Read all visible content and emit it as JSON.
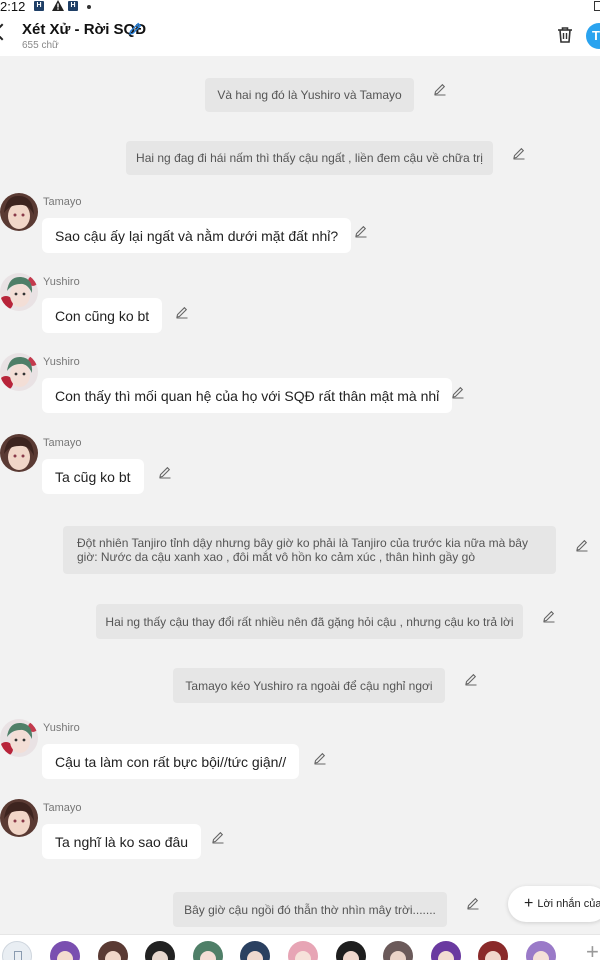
{
  "status": {
    "time": "2:12"
  },
  "header": {
    "title": "Xét Xử - Rời SQĐ",
    "subtitle": "655 chữ",
    "avatar_letter": "T"
  },
  "narrations": [
    "Và hai ng đó là Yushiro và Tamayo",
    "Hai ng đag đi hái nấm thì thấy cậu ngất , liền đem cậu về chữa trị",
    "Đột nhiên Tanjiro tỉnh dậy nhưng bây giờ ko phải là Tanjiro của trước kia nữa mà bây giờ: Nước da cậu xanh xao , đôi mắt vô hồn ko cảm xúc , thân hình gầy gò",
    "Hai ng thấy cậu thay đổi rất nhiều nên đã gặng hỏi cậu , nhưng cậu ko trả lời",
    "Tamayo kéo Yushiro ra ngoài để cậu nghỉ ngơi",
    "Bây giờ cậu ngồi đó thẫn thờ nhìn mây trời......."
  ],
  "messages": [
    {
      "speaker": "Tamayo",
      "text": "Sao cậu ấy lại ngất và nằm dưới mặt đất nhỉ?"
    },
    {
      "speaker": "Yushiro",
      "text": "Con cũng ko bt"
    },
    {
      "speaker": "Yushiro",
      "text": "Con thấy thì mối quan hệ của họ với SQĐ rất thân mật mà nhỉ"
    },
    {
      "speaker": "Tamayo",
      "text": "Ta cũg ko bt"
    },
    {
      "speaker": "Yushiro",
      "text": "Cậu ta làm con rất bực bội//tức giận//"
    },
    {
      "speaker": "Tamayo",
      "text": "Ta nghĩ là ko sao đâu"
    }
  ],
  "reply_button": {
    "label": "Lời nhắn của"
  },
  "colors": {
    "accent": "#2aa3ef",
    "background": "#f2f2f2",
    "narration_bg": "#e6e6e6",
    "bubble_bg": "#ffffff"
  },
  "icons": {
    "back": "chevron-left-icon",
    "edit_title": "pencil-icon",
    "delete": "trash-icon",
    "edit_line": "pencil-icon",
    "add": "plus-icon"
  }
}
